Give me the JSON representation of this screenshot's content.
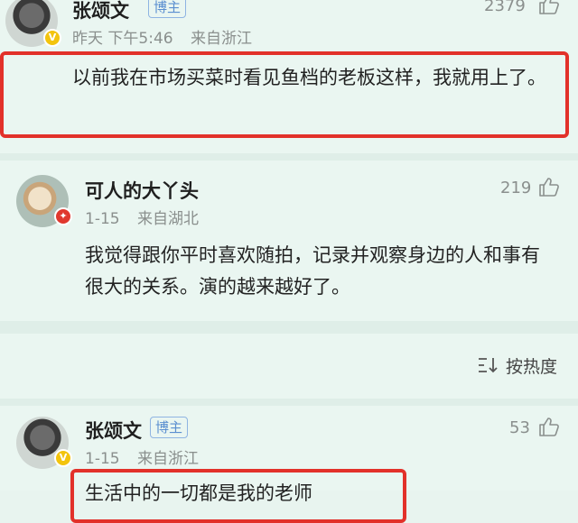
{
  "comments": [
    {
      "author": "张颂文",
      "badge": "博主",
      "time": "昨天 下午5:46",
      "location": "来自浙江",
      "likes": "2379",
      "text": "以前我在市场买菜时看见鱼档的老板这样，我就用上了。"
    },
    {
      "author": "可人的大丫头",
      "time": "1-15",
      "location": "来自湖北",
      "likes": "219",
      "text": "我觉得跟你平时喜欢随拍，记录并观察身边的人和事有很大的关系。演的越来越好了。"
    },
    {
      "author": "张颂文",
      "badge": "博主",
      "time": "1-15",
      "location": "来自浙江",
      "likes": "53",
      "text": "生活中的一切都是我的老师"
    }
  ],
  "sort": {
    "label": "按热度",
    "icon": "sort-icon"
  },
  "colors": {
    "highlight": "#e2312a",
    "badge": "#5b8fd0",
    "vip": "#f3c40d"
  }
}
